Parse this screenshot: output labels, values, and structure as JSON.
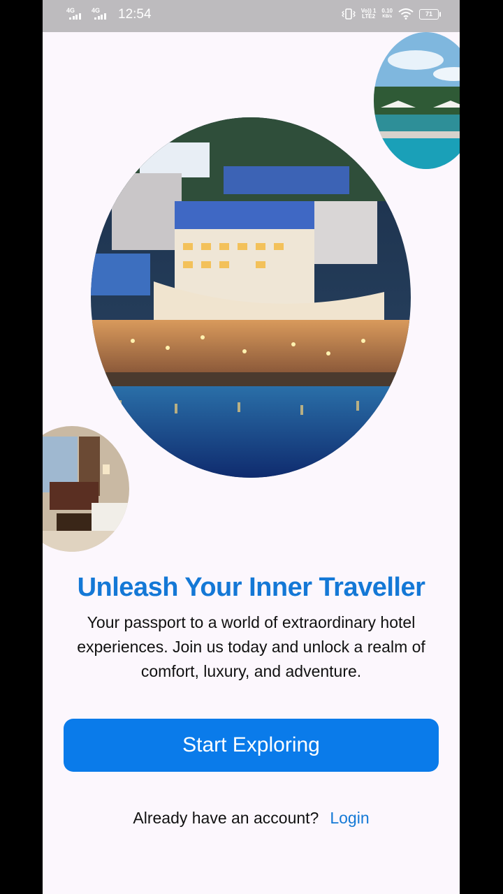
{
  "status_bar": {
    "network_1": "4G",
    "network_2": "4G",
    "time": "12:54",
    "volte_top": "Vo)) 1",
    "volte_bottom": "LTE2",
    "speed_top": "0.10",
    "speed_bottom": "KB/s",
    "battery": "71"
  },
  "hero": {
    "main_image": "hotel-aerial-night-image",
    "pool_image": "pool-cabanas-image",
    "room_image": "hotel-room-image"
  },
  "headline": "Unleash Your Inner Traveller",
  "description": "Your passport to a world of extraordinary hotel experiences. Join us today and unlock a realm of comfort, luxury, and adventure.",
  "cta_label": "Start Exploring",
  "account_prompt": "Already have an account?",
  "login_label": "Login",
  "colors": {
    "accent": "#0a7bea",
    "headline": "#1478d6",
    "background": "#fcf7fd",
    "status_bar": "#bdbbbe"
  }
}
